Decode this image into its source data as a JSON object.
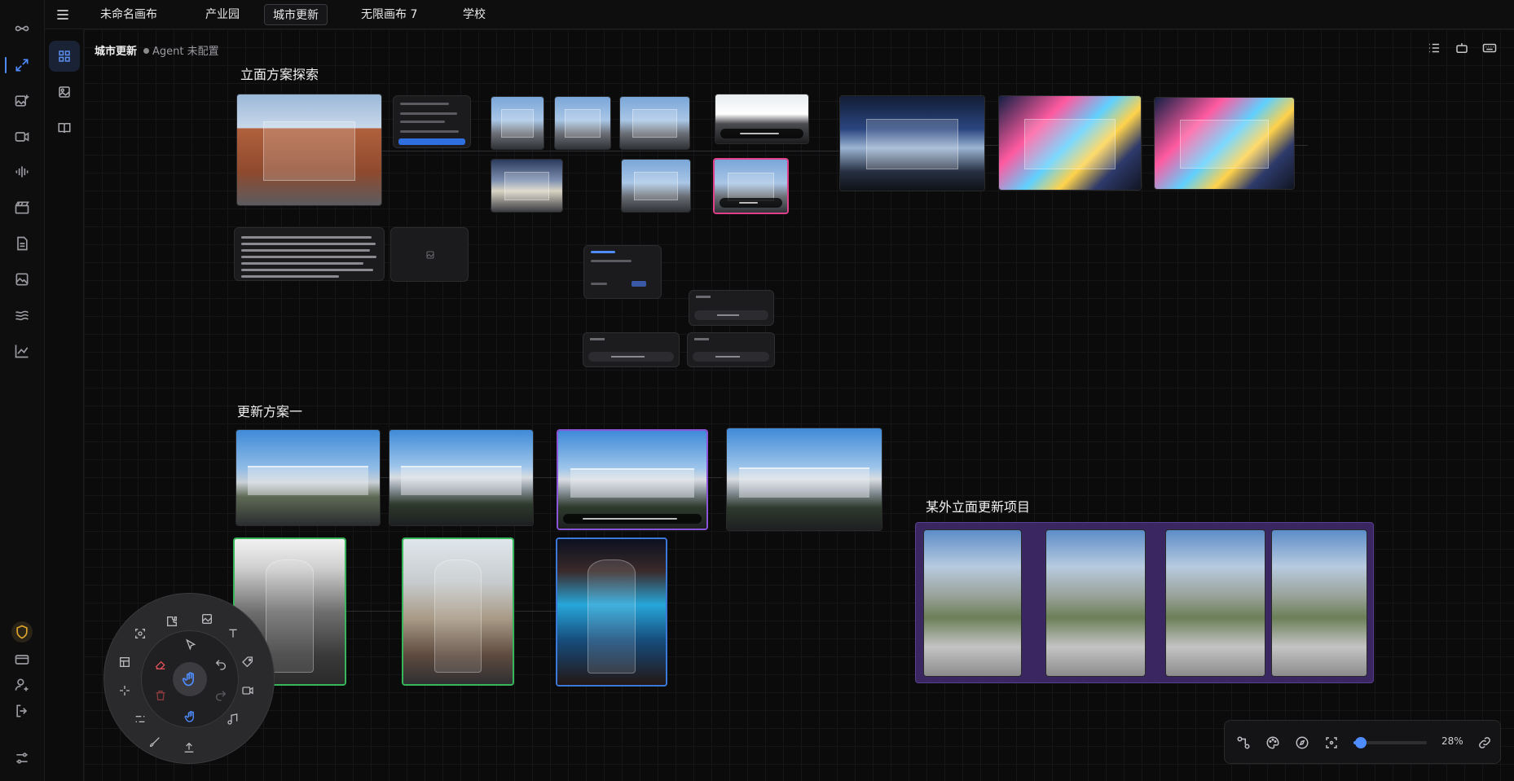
{
  "tabs": [
    "未命名画布",
    "产业园",
    "城市更新",
    "无限画布 7",
    "学校"
  ],
  "active_tab": 2,
  "breadcrumb": {
    "name": "城市更新",
    "agent": "Agent 未配置"
  },
  "sections": {
    "facade": "立面方案探索",
    "update_one": "更新方案一",
    "exterior": "某外立面更新项目"
  },
  "zoom": {
    "label": "28%",
    "value": 0.28
  },
  "icons": {
    "rail": [
      "logo-infinity-icon",
      "expand-icon",
      "image-add-icon",
      "video-icon",
      "audio-wave-icon",
      "clapper-icon",
      "document-icon",
      "gallery-icon",
      "waves-icon",
      "chart-icon",
      "shield-icon",
      "card-icon",
      "user-settings-icon",
      "logout-icon",
      "sliders-icon"
    ],
    "secondary": [
      "grid-icon",
      "image-icon",
      "book-icon"
    ],
    "top_right": [
      "list-icon",
      "robot-icon",
      "keyboard-icon"
    ],
    "zoombar": [
      "nodes-icon",
      "palette-icon",
      "compass-icon",
      "focus-icon",
      "link-icon"
    ]
  }
}
